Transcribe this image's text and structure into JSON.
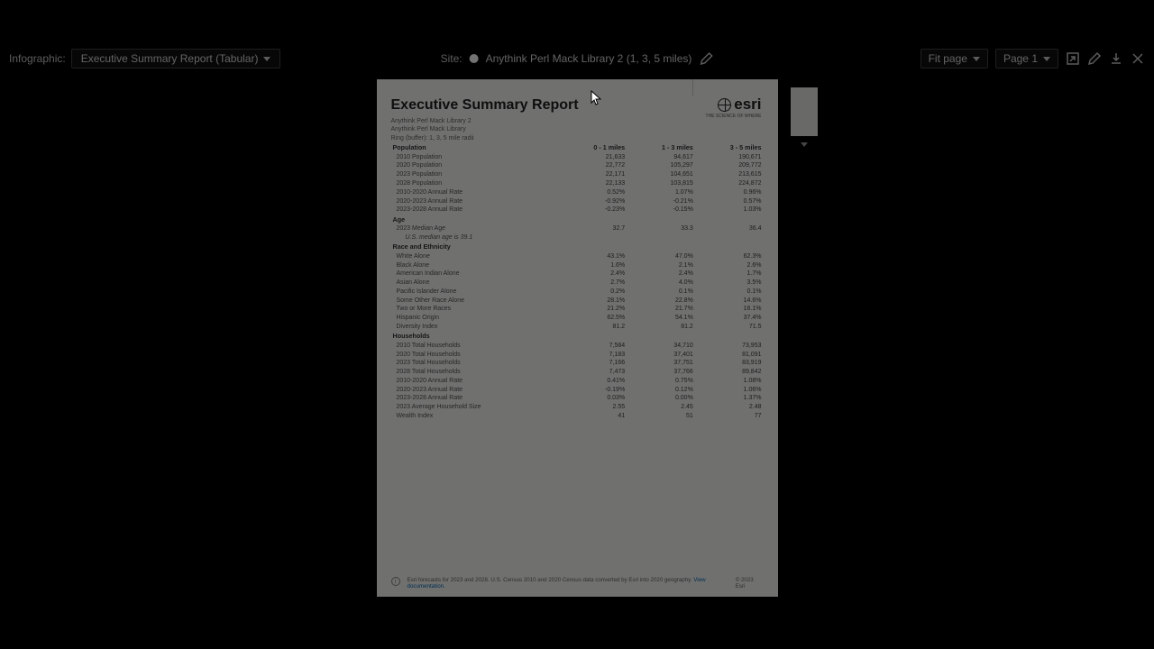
{
  "toolbar": {
    "infographic_label": "Infographic:",
    "infographic_value": "Executive Summary Report (Tabular)",
    "site_label": "Site:",
    "site_value": "Anythink Perl Mack Library 2 (1, 3, 5 miles)",
    "zoom_value": "Fit page",
    "page_value": "Page 1",
    "icons": {
      "pencil": "pencil-icon",
      "export": "export-icon",
      "edit": "edit-icon",
      "download": "download-icon",
      "close": "close-icon"
    }
  },
  "report": {
    "title": "Executive Summary Report",
    "subtitle1": "Anythink Perl Mack Library 2",
    "subtitle2": "Anythink Perl Mack Library",
    "subtitle3": "Ring (buffer): 1, 3, 5 mile radii",
    "logo_text": "esri",
    "logo_sub": "THE SCIENCE OF WHERE",
    "columns": [
      "0 - 1 miles",
      "1 - 3 miles",
      "3 - 5 miles"
    ],
    "sections": [
      {
        "head": "Population",
        "rows": [
          {
            "label": "2010 Population",
            "v": [
              "21,633",
              "94,617",
              "190,671"
            ]
          },
          {
            "label": "2020 Population",
            "v": [
              "22,772",
              "105,297",
              "209,772"
            ]
          },
          {
            "label": "2023 Population",
            "v": [
              "22,171",
              "104,651",
              "213,615"
            ]
          },
          {
            "label": "2028 Population",
            "v": [
              "22,133",
              "103,815",
              "224,872"
            ]
          },
          {
            "label": "2010-2020 Annual Rate",
            "v": [
              "0.52%",
              "1.07%",
              "0.96%"
            ]
          },
          {
            "label": "2020-2023 Annual Rate",
            "v": [
              "-0.92%",
              "-0.21%",
              "0.57%"
            ]
          },
          {
            "label": "2023-2028 Annual Rate",
            "v": [
              "-0.23%",
              "-0.15%",
              "1.03%"
            ]
          }
        ]
      },
      {
        "head": "Age",
        "rows": [
          {
            "label": "2023 Median Age",
            "v": [
              "32.7",
              "33.3",
              "36.4"
            ]
          },
          {
            "label": "U.S. median age is 39.1",
            "indent": true,
            "v": [
              "",
              "",
              ""
            ]
          }
        ]
      },
      {
        "head": "Race and Ethnicity",
        "rows": [
          {
            "label": "White Alone",
            "v": [
              "43.1%",
              "47.0%",
              "62.3%"
            ]
          },
          {
            "label": "Black Alone",
            "v": [
              "1.6%",
              "2.1%",
              "2.6%"
            ]
          },
          {
            "label": "American Indian Alone",
            "v": [
              "2.4%",
              "2.4%",
              "1.7%"
            ]
          },
          {
            "label": "Asian Alone",
            "v": [
              "2.7%",
              "4.0%",
              "3.5%"
            ]
          },
          {
            "label": "Pacific Islander Alone",
            "v": [
              "0.2%",
              "0.1%",
              "0.1%"
            ]
          },
          {
            "label": "Some Other Race Alone",
            "v": [
              "28.1%",
              "22.8%",
              "14.6%"
            ]
          },
          {
            "label": "Two or More Races",
            "v": [
              "21.2%",
              "21.7%",
              "16.1%"
            ]
          },
          {
            "label": "Hispanic Origin",
            "v": [
              "62.5%",
              "54.1%",
              "37.4%"
            ]
          },
          {
            "label": "Diversity Index",
            "v": [
              "81.2",
              "81.2",
              "71.5"
            ]
          }
        ]
      },
      {
        "head": "Households",
        "rows": [
          {
            "label": "2010 Total Households",
            "v": [
              "7,584",
              "34,710",
              "73,953"
            ]
          },
          {
            "label": "2020 Total Households",
            "v": [
              "7,183",
              "37,401",
              "81,091"
            ]
          },
          {
            "label": "2023 Total Households",
            "v": [
              "7,166",
              "37,751",
              "83,919"
            ]
          },
          {
            "label": "2028 Total Households",
            "v": [
              "7,473",
              "37,766",
              "89,842"
            ]
          },
          {
            "label": "2010-2020 Annual Rate",
            "v": [
              "0.41%",
              "0.75%",
              "1.08%"
            ]
          },
          {
            "label": "2020-2023 Annual Rate",
            "v": [
              "-0.19%",
              "0.12%",
              "1.06%"
            ]
          },
          {
            "label": "2023-2028 Annual Rate",
            "v": [
              "0.03%",
              "0.00%",
              "1.37%"
            ]
          },
          {
            "label": "2023 Average Household Size",
            "v": [
              "2.55",
              "2.45",
              "2.48"
            ]
          },
          {
            "label": "Wealth Index",
            "v": [
              "41",
              "51",
              "77"
            ]
          }
        ]
      }
    ],
    "footer_text": "Esri forecasts for 2023 and 2028. U.S. Census 2010 and 2020 Census data converted by Esri into 2020 geography.",
    "footer_link": "View documentation.",
    "copyright": "© 2023 Esri"
  }
}
